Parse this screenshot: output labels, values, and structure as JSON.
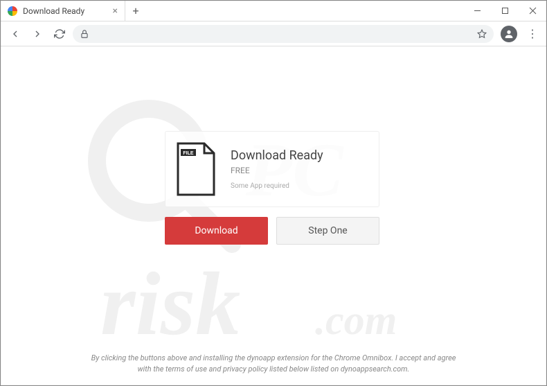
{
  "tab": {
    "title": "Download Ready"
  },
  "card": {
    "title": "Download Ready",
    "subtitle": "FREE",
    "note": "Some App required",
    "file_label": "FILE"
  },
  "actions": {
    "download": "Download",
    "step_one": "Step One"
  },
  "disclaimer": "By clicking the buttons above and installing the dynoapp extension for the Chrome Omnibox. I accept and agree with the terms of use and privacy policy listed below listed on dynoappsearch.com."
}
